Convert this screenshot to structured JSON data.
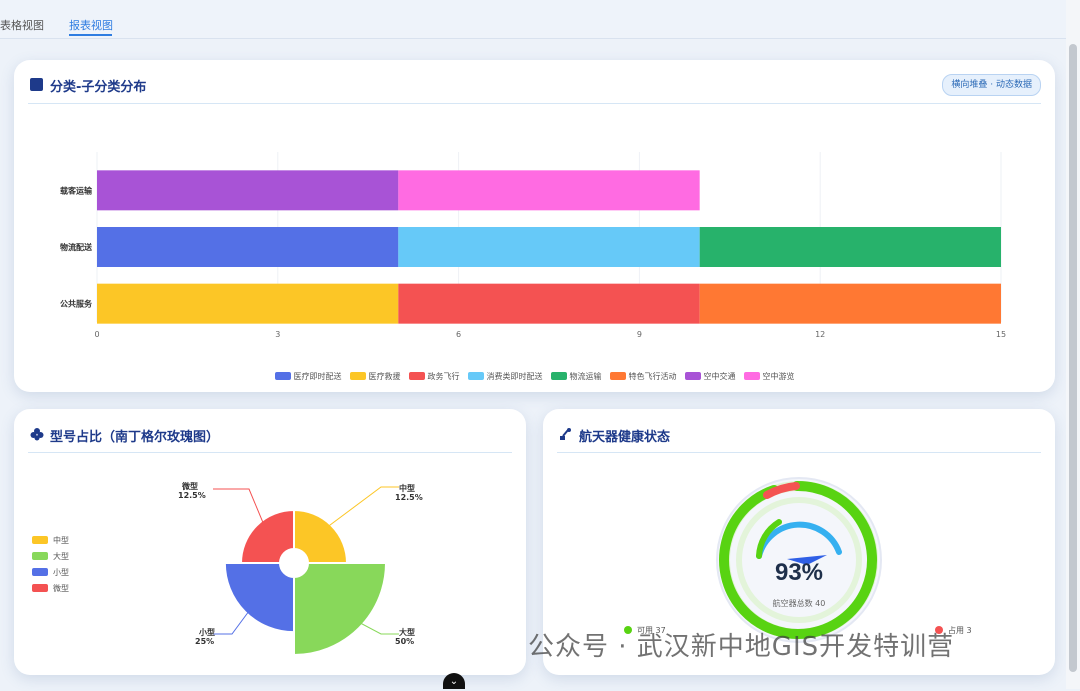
{
  "tabs": [
    {
      "label": "表格视图",
      "active": false
    },
    {
      "label": "报表视图",
      "active": true
    }
  ],
  "distribution_card": {
    "title": "分类-子分类分布",
    "badge": "横向堆叠 · 动态数据"
  },
  "model_card": {
    "title": "型号占比（南丁格尔玫瑰图）"
  },
  "health_card": {
    "title": "航天器健康状态",
    "gauge": {
      "percent": "93%",
      "caption": "航空器总数 40",
      "available_label": "可用 37",
      "occupied_label": "占用 3",
      "available": 37,
      "occupied": 3,
      "total": 40
    }
  },
  "chart_data": [
    {
      "type": "bar",
      "orientation": "horizontal",
      "stacked": true,
      "categories": [
        "公共服务",
        "物流配送",
        "载客运输"
      ],
      "x_ticks": [
        0,
        3,
        6,
        9,
        12,
        15
      ],
      "xlim": [
        0,
        15
      ],
      "series": [
        {
          "name": "医疗即时配送",
          "color": "#5470e6",
          "values": [
            0,
            5,
            0
          ]
        },
        {
          "name": "医疗救援",
          "color": "#fcc626",
          "values": [
            5,
            0,
            0
          ]
        },
        {
          "name": "政务飞行",
          "color": "#f45252",
          "values": [
            5,
            0,
            0
          ]
        },
        {
          "name": "消费类即时配送",
          "color": "#66c9f8",
          "values": [
            0,
            5,
            0
          ]
        },
        {
          "name": "物流运输",
          "color": "#27b26b",
          "values": [
            0,
            5,
            0
          ]
        },
        {
          "name": "特色飞行活动",
          "color": "#ff7833",
          "values": [
            5,
            0,
            0
          ]
        },
        {
          "name": "空中交通",
          "color": "#a853d6",
          "values": [
            0,
            0,
            5
          ]
        },
        {
          "name": "空中游览",
          "color": "#ff6be2",
          "values": [
            0,
            0,
            5
          ]
        }
      ],
      "grid": true,
      "legend_position": "bottom"
    },
    {
      "type": "pie",
      "variant": "nightingale-rose",
      "legend_position": "left",
      "slices": [
        {
          "name": "中型",
          "value": 12.5,
          "label": "12.5%",
          "color": "#fcc626"
        },
        {
          "name": "大型",
          "value": 50,
          "label": "50%",
          "color": "#88d85a"
        },
        {
          "name": "小型",
          "value": 25,
          "label": "25%",
          "color": "#5470e6"
        },
        {
          "name": "微型",
          "value": 12.5,
          "label": "12.5%",
          "color": "#f45252"
        }
      ]
    }
  ],
  "watermark": "公众号 · 武汉新中地GIS开发特训营",
  "colors": {
    "accent": "#2f7de1",
    "title": "#1e3a8a",
    "gauge_green": "#58d312",
    "gauge_red": "#f45252"
  }
}
